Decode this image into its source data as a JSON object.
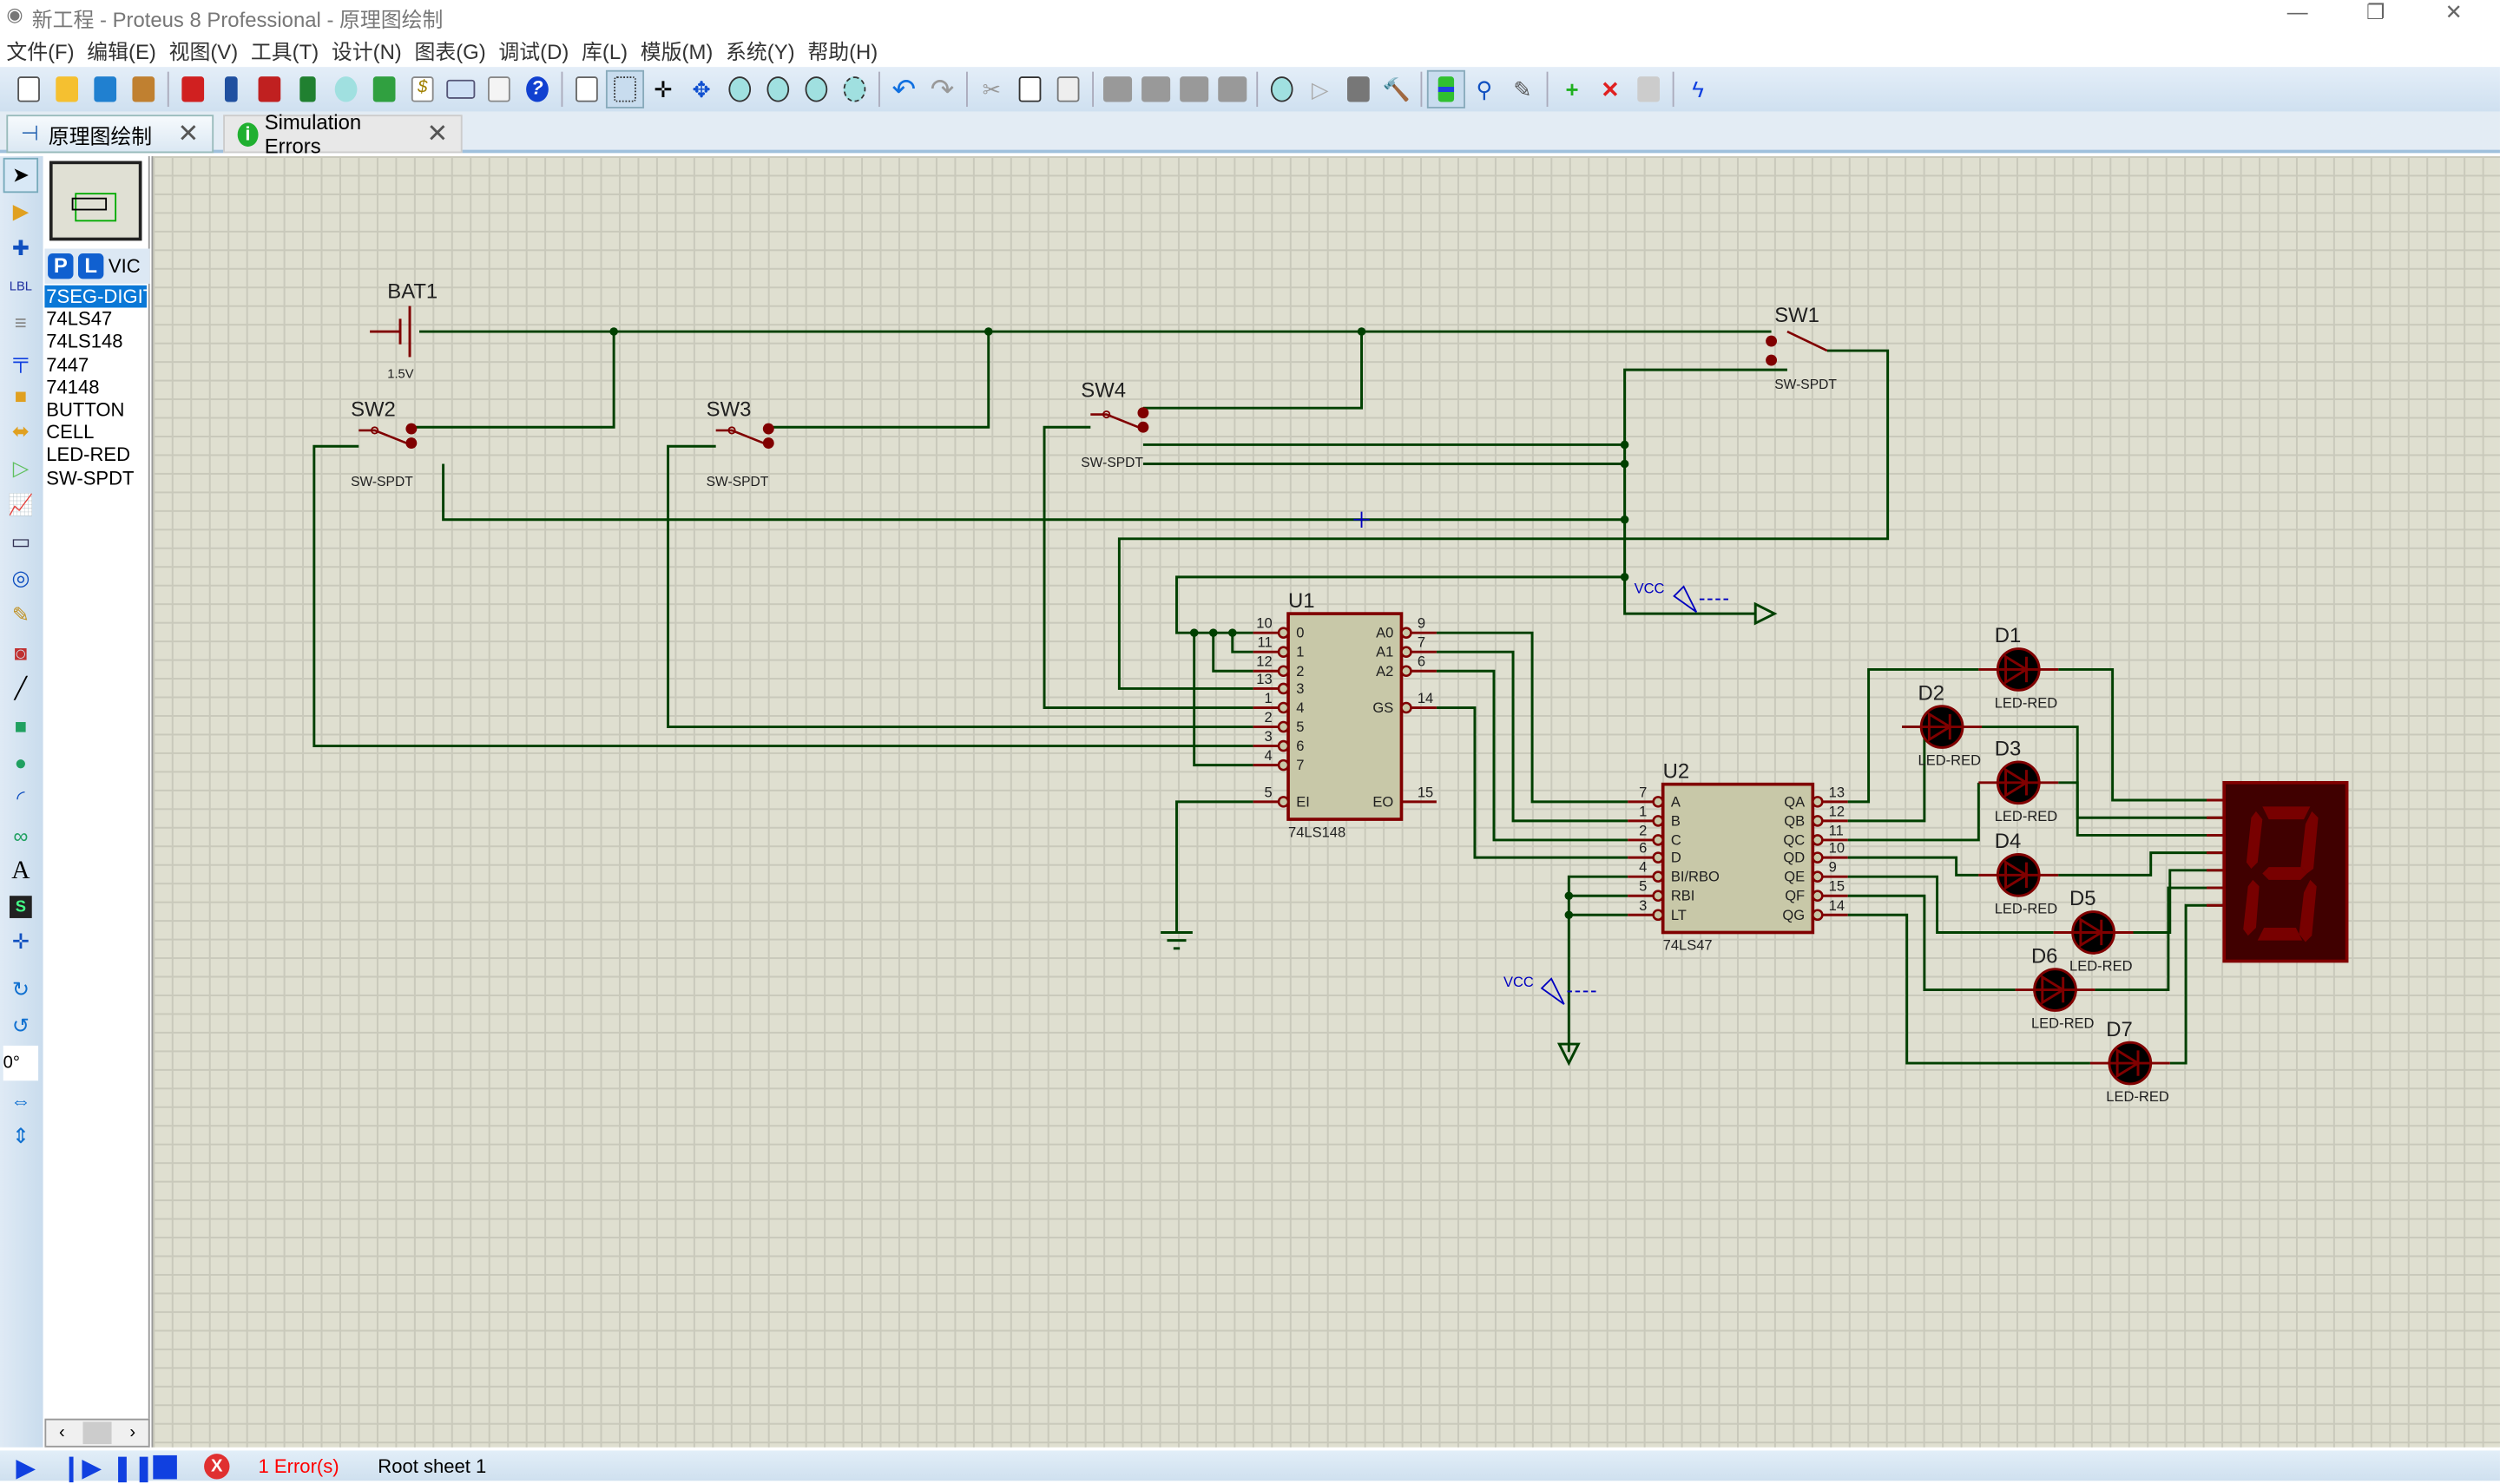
{
  "window": {
    "title": "新工程 - Proteus 8 Professional - 原理图绘制"
  },
  "menu": [
    "文件(F)",
    "编辑(E)",
    "视图(V)",
    "工具(T)",
    "设计(N)",
    "图表(G)",
    "调试(D)",
    "库(L)",
    "模版(M)",
    "系统(Y)",
    "帮助(H)"
  ],
  "tabs": [
    {
      "label": "原理图绘制",
      "icon": "schematic-icon"
    },
    {
      "label": "Simulation Errors",
      "icon": "info-icon"
    }
  ],
  "panel": {
    "p_label": "P",
    "l_label": "L",
    "mode_label": "VIC",
    "devices": [
      "7SEG-DIGIT",
      "74LS47",
      "74LS148",
      "7447",
      "74148",
      "BUTTON",
      "CELL",
      "LED-RED",
      "SW-SPDT"
    ],
    "selected": "7SEG-DIGIT",
    "rotation": "0°"
  },
  "schematic": {
    "bat": {
      "ref": "BAT1",
      "value": "1.5V"
    },
    "switches": [
      {
        "ref": "SW1",
        "type": "SW-SPDT"
      },
      {
        "ref": "SW2",
        "type": "SW-SPDT"
      },
      {
        "ref": "SW3",
        "type": "SW-SPDT"
      },
      {
        "ref": "SW4",
        "type": "SW-SPDT"
      }
    ],
    "u1": {
      "ref": "U1",
      "part": "74LS148",
      "left_pins": [
        [
          "10",
          "0"
        ],
        [
          "11",
          "1"
        ],
        [
          "12",
          "2"
        ],
        [
          "13",
          "3"
        ],
        [
          "1",
          "4"
        ],
        [
          "2",
          "5"
        ],
        [
          "3",
          "6"
        ],
        [
          "4",
          "7"
        ]
      ],
      "ei": [
        "5",
        "EI"
      ],
      "right_pins": [
        [
          "9",
          "A0"
        ],
        [
          "7",
          "A1"
        ],
        [
          "6",
          "A2"
        ],
        [
          "14",
          "GS"
        ]
      ],
      "eo": [
        "15",
        "EO"
      ]
    },
    "u2": {
      "ref": "U2",
      "part": "74LS47",
      "left_pins": [
        [
          "7",
          "A"
        ],
        [
          "1",
          "B"
        ],
        [
          "2",
          "C"
        ],
        [
          "6",
          "D"
        ],
        [
          "4",
          "BI/RBO"
        ],
        [
          "5",
          "RBI"
        ],
        [
          "3",
          "LT"
        ]
      ],
      "right_pins": [
        [
          "13",
          "QA"
        ],
        [
          "12",
          "QB"
        ],
        [
          "11",
          "QC"
        ],
        [
          "10",
          "QD"
        ],
        [
          "9",
          "QE"
        ],
        [
          "15",
          "QF"
        ],
        [
          "14",
          "QG"
        ]
      ]
    },
    "leds": [
      {
        "ref": "D1",
        "type": "LED-RED"
      },
      {
        "ref": "D2",
        "type": "LED-RED"
      },
      {
        "ref": "D3",
        "type": "LED-RED"
      },
      {
        "ref": "D4",
        "type": "LED-RED"
      },
      {
        "ref": "D5",
        "type": "LED-RED"
      },
      {
        "ref": "D6",
        "type": "LED-RED"
      },
      {
        "ref": "D7",
        "type": "LED-RED"
      }
    ],
    "vcc_label": "VCC",
    "colors": {
      "wire": "#004000",
      "component": "#800000",
      "body": "#c8c8a8",
      "label": "#202020",
      "power": "#0000c0",
      "sevenseg_bg": "#400000",
      "sevenseg_seg": "#780000"
    }
  },
  "status": {
    "errors": "1 Error(s)",
    "sheet": "Root sheet 1"
  }
}
